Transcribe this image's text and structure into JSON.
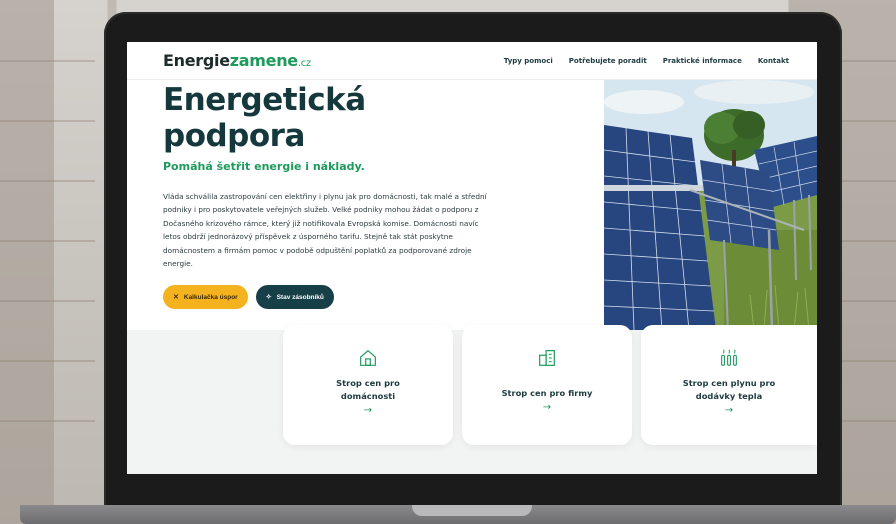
{
  "site": {
    "logo_part1": "Energie",
    "logo_part2": "zamene",
    "logo_part3": ".cz",
    "nav": [
      "Typy pomoci",
      "Potřebujete poradit",
      "Praktické informace",
      "Kontakt"
    ]
  },
  "hero": {
    "title": "Energetická podpora",
    "subtitle": "Pomáhá šetřit energie i náklady.",
    "body": "Vláda schválila zastropování cen elektřiny i plynu jak pro domácnosti, tak malé a střední podniky i pro poskytovatele veřejných služeb. Velké podniky mohou žádat o podporu z Dočasného krizového rámce, který již notifikovala Evropská komise. Domácnosti navíc letos obdrží jednorázový příspěvek z úsporného tarifu. Stejně tak stát poskytne domácnostem a firmám pomoc v podobě odpuštění poplatků za podporované zdroje energie.",
    "btn_primary": "Kalkulačka úspor",
    "btn_primary_icon": "✕",
    "btn_secondary": "Stav zásobníků",
    "btn_secondary_icon": "✧"
  },
  "cards": [
    {
      "title": "Strop cen pro domácnosti",
      "icon": "house-icon",
      "arrow": "→"
    },
    {
      "title": "Strop cen pro firmy",
      "icon": "building-icon",
      "arrow": "→"
    },
    {
      "title": "Strop cen plynu pro dodávky tepla",
      "icon": "radiator-icon",
      "arrow": "→"
    }
  ],
  "colors": {
    "brand_green": "#1e9a5c",
    "dark_teal": "#173f47",
    "accent_yellow": "#f5b21f",
    "section_bg": "#f2f3f3"
  }
}
